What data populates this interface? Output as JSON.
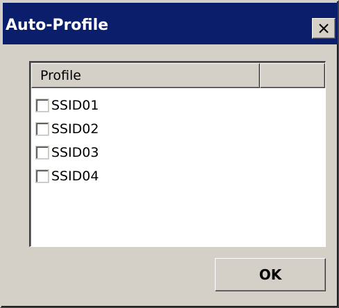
{
  "window": {
    "title": "Auto-Profile",
    "close_icon": "close-x-icon"
  },
  "list": {
    "columns": [
      "Profile",
      ""
    ],
    "items": [
      {
        "label": "SSID01",
        "checked": false
      },
      {
        "label": "SSID02",
        "checked": false
      },
      {
        "label": "SSID03",
        "checked": false
      },
      {
        "label": "SSID04",
        "checked": false
      }
    ]
  },
  "buttons": {
    "ok_label": "OK"
  },
  "colors": {
    "titlebar": "#0a1e6b",
    "face": "#d4d0c8",
    "list_background": "#ffffff"
  }
}
